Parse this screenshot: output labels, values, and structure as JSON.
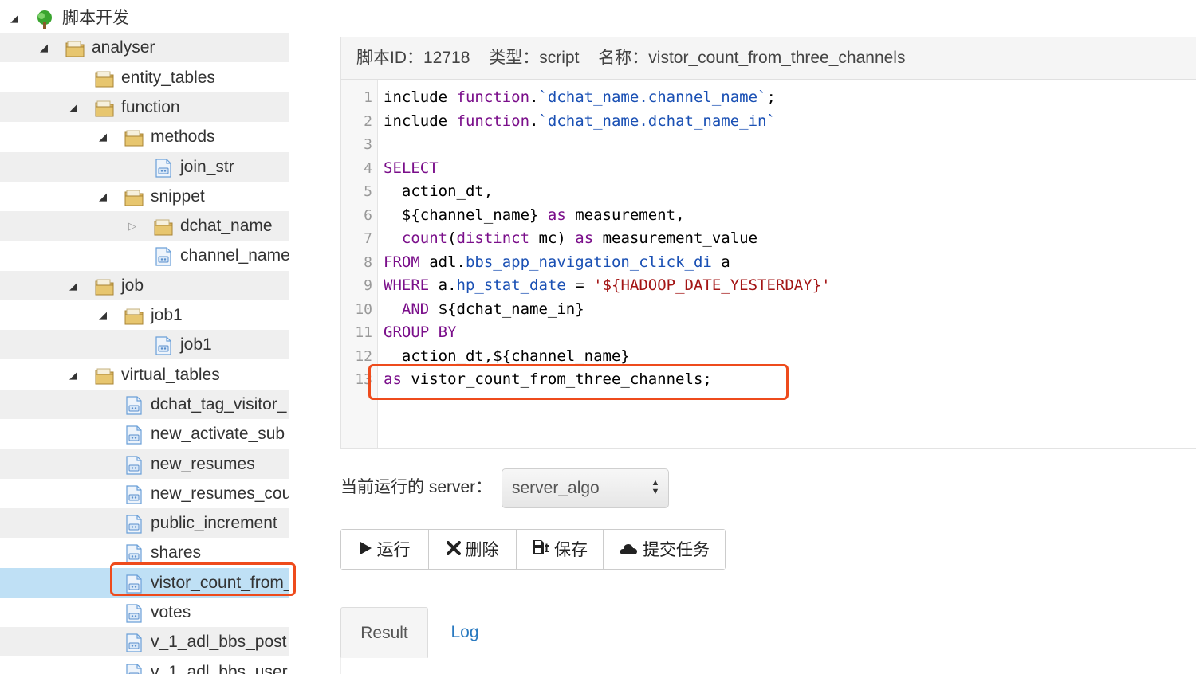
{
  "tree": [
    {
      "label": "脚本开发",
      "depth": 0,
      "kind": "root",
      "toggle": "open"
    },
    {
      "label": "analyser",
      "depth": 1,
      "kind": "folder",
      "toggle": "open"
    },
    {
      "label": "entity_tables",
      "depth": 2,
      "kind": "folder",
      "toggle": "none"
    },
    {
      "label": "function",
      "depth": 2,
      "kind": "folder",
      "toggle": "open"
    },
    {
      "label": "methods",
      "depth": 3,
      "kind": "folder",
      "toggle": "open"
    },
    {
      "label": "join_str",
      "depth": 4,
      "kind": "file",
      "toggle": "none"
    },
    {
      "label": "snippet",
      "depth": 3,
      "kind": "folder",
      "toggle": "open"
    },
    {
      "label": "dchat_name",
      "depth": 4,
      "kind": "folder",
      "toggle": "closed"
    },
    {
      "label": "channel_name",
      "depth": 4,
      "kind": "file",
      "toggle": "none"
    },
    {
      "label": "job",
      "depth": 2,
      "kind": "folder",
      "toggle": "open"
    },
    {
      "label": "job1",
      "depth": 3,
      "kind": "folder",
      "toggle": "open"
    },
    {
      "label": "job1",
      "depth": 4,
      "kind": "file",
      "toggle": "none"
    },
    {
      "label": "virtual_tables",
      "depth": 2,
      "kind": "folder",
      "toggle": "open"
    },
    {
      "label": "dchat_tag_visitor_",
      "depth": 3,
      "kind": "file",
      "toggle": "none"
    },
    {
      "label": "new_activate_sub",
      "depth": 3,
      "kind": "file",
      "toggle": "none"
    },
    {
      "label": "new_resumes",
      "depth": 3,
      "kind": "file",
      "toggle": "none"
    },
    {
      "label": "new_resumes_cou",
      "depth": 3,
      "kind": "file",
      "toggle": "none"
    },
    {
      "label": "public_increment",
      "depth": 3,
      "kind": "file",
      "toggle": "none"
    },
    {
      "label": "shares",
      "depth": 3,
      "kind": "file",
      "toggle": "none"
    },
    {
      "label": "vistor_count_from_",
      "depth": 3,
      "kind": "file",
      "toggle": "none",
      "selected": true
    },
    {
      "label": "votes",
      "depth": 3,
      "kind": "file",
      "toggle": "none"
    },
    {
      "label": "v_1_adl_bbs_post",
      "depth": 3,
      "kind": "file",
      "toggle": "none"
    },
    {
      "label": "v_1_adl_bbs_user",
      "depth": 3,
      "kind": "file",
      "toggle": "none"
    }
  ],
  "header": {
    "id_label": "脚本ID：12718",
    "type_label": "类型：script",
    "name_label": "名称：vistor_count_from_three_channels"
  },
  "code_lines": [
    [
      [
        "t",
        "include "
      ],
      [
        "fn",
        "function"
      ],
      [
        "t",
        "."
      ],
      [
        "bt",
        "`dchat_name.channel_name`"
      ],
      [
        "t",
        ";"
      ]
    ],
    [
      [
        "t",
        "include "
      ],
      [
        "fn",
        "function"
      ],
      [
        "t",
        "."
      ],
      [
        "bt",
        "`dchat_name.dchat_name_in`"
      ]
    ],
    [],
    [
      [
        "kw",
        "SELECT"
      ]
    ],
    [
      [
        "t",
        "  action_dt,"
      ]
    ],
    [
      [
        "t",
        "  ${channel_name} "
      ],
      [
        "kw",
        "as"
      ],
      [
        "t",
        " measurement,"
      ]
    ],
    [
      [
        "t",
        "  "
      ],
      [
        "fn",
        "count"
      ],
      [
        "t",
        "("
      ],
      [
        "kw",
        "distinct"
      ],
      [
        "t",
        " mc) "
      ],
      [
        "kw",
        "as"
      ],
      [
        "t",
        " measurement_value"
      ]
    ],
    [
      [
        "kw",
        "FROM"
      ],
      [
        "t",
        " adl."
      ],
      [
        "pr",
        "bbs_app_navigation_click_di"
      ],
      [
        "t",
        " a"
      ]
    ],
    [
      [
        "kw",
        "WHERE"
      ],
      [
        "t",
        " a."
      ],
      [
        "pr",
        "hp_stat_date"
      ],
      [
        "t",
        " = "
      ],
      [
        "st",
        "'${HADOOP_DATE_YESTERDAY}'"
      ]
    ],
    [
      [
        "t",
        "  "
      ],
      [
        "kw",
        "AND"
      ],
      [
        "t",
        " ${dchat_name_in}"
      ]
    ],
    [
      [
        "kw",
        "GROUP BY"
      ]
    ],
    [
      [
        "t",
        "  action_dt,${channel_name}"
      ]
    ],
    [
      [
        "kw",
        "as"
      ],
      [
        "t",
        " vistor_count_from_three_channels;"
      ]
    ]
  ],
  "server": {
    "label": "当前运行的 server：",
    "value": "server_algo"
  },
  "buttons": [
    {
      "name": "run-button",
      "icon": "play-icon",
      "label": "运行"
    },
    {
      "name": "delete-button",
      "icon": "close-icon",
      "label": "删除"
    },
    {
      "name": "save-button",
      "icon": "save-icon",
      "label": "保存"
    },
    {
      "name": "submit-task-button",
      "icon": "cloud-icon",
      "label": "提交任务"
    }
  ],
  "tabs": [
    {
      "label": "Result",
      "active": true
    },
    {
      "label": "Log",
      "active": false
    }
  ],
  "colors": {
    "highlight": "#ee4b1c",
    "selected_row": "#bfe0f5",
    "keyword": "#7a0e8a",
    "identifier": "#1a50b4",
    "string": "#a31515"
  }
}
